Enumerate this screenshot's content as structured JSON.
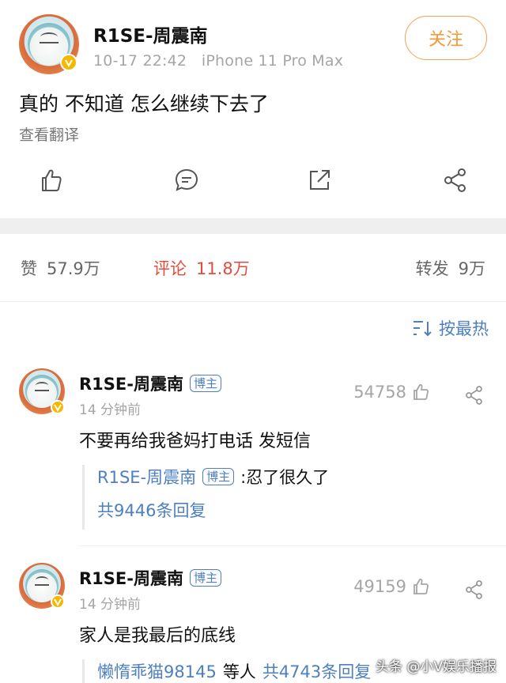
{
  "post": {
    "author": "R1SE-周震南",
    "meta": "10-17 22:42   iPhone 11 Pro Max",
    "follow_label": "关注",
    "text": "真的 不知道 怎么继续下去了",
    "translate_label": "查看翻译",
    "actions": [
      "like-icon",
      "comment-icon",
      "repost-icon",
      "share-icon"
    ]
  },
  "stats": {
    "like_label": "赞",
    "like_count": "57.9万",
    "comment_label": "评论",
    "comment_count": "11.8万",
    "repost_label": "转发",
    "repost_count": "9万"
  },
  "sort": {
    "label": "按最热"
  },
  "comments": [
    {
      "author": "R1SE-周震南",
      "tag": "博主",
      "time": "14 分钟前",
      "likes": "54758",
      "text": "不要再给我爸妈打电话 发短信",
      "reply": {
        "author": "R1SE-周震南",
        "tag": "博主",
        "text": ":忍了很久了",
        "count_label": "共9446条回复"
      }
    },
    {
      "author": "R1SE-周震南",
      "tag": "博主",
      "time": "14 分钟前",
      "likes": "49159",
      "text": "家人是我最后的底线",
      "reply": {
        "author": "懒惰乖猫98145",
        "middle": "等人",
        "count_label": "共4743条回复"
      }
    }
  ],
  "watermark": "头条 @小V娱乐播报",
  "colors": {
    "accent_orange": "#f09a3a",
    "link_blue": "#4d7fc1",
    "comment_red": "#e24c3c",
    "muted": "#a5a5a5"
  }
}
